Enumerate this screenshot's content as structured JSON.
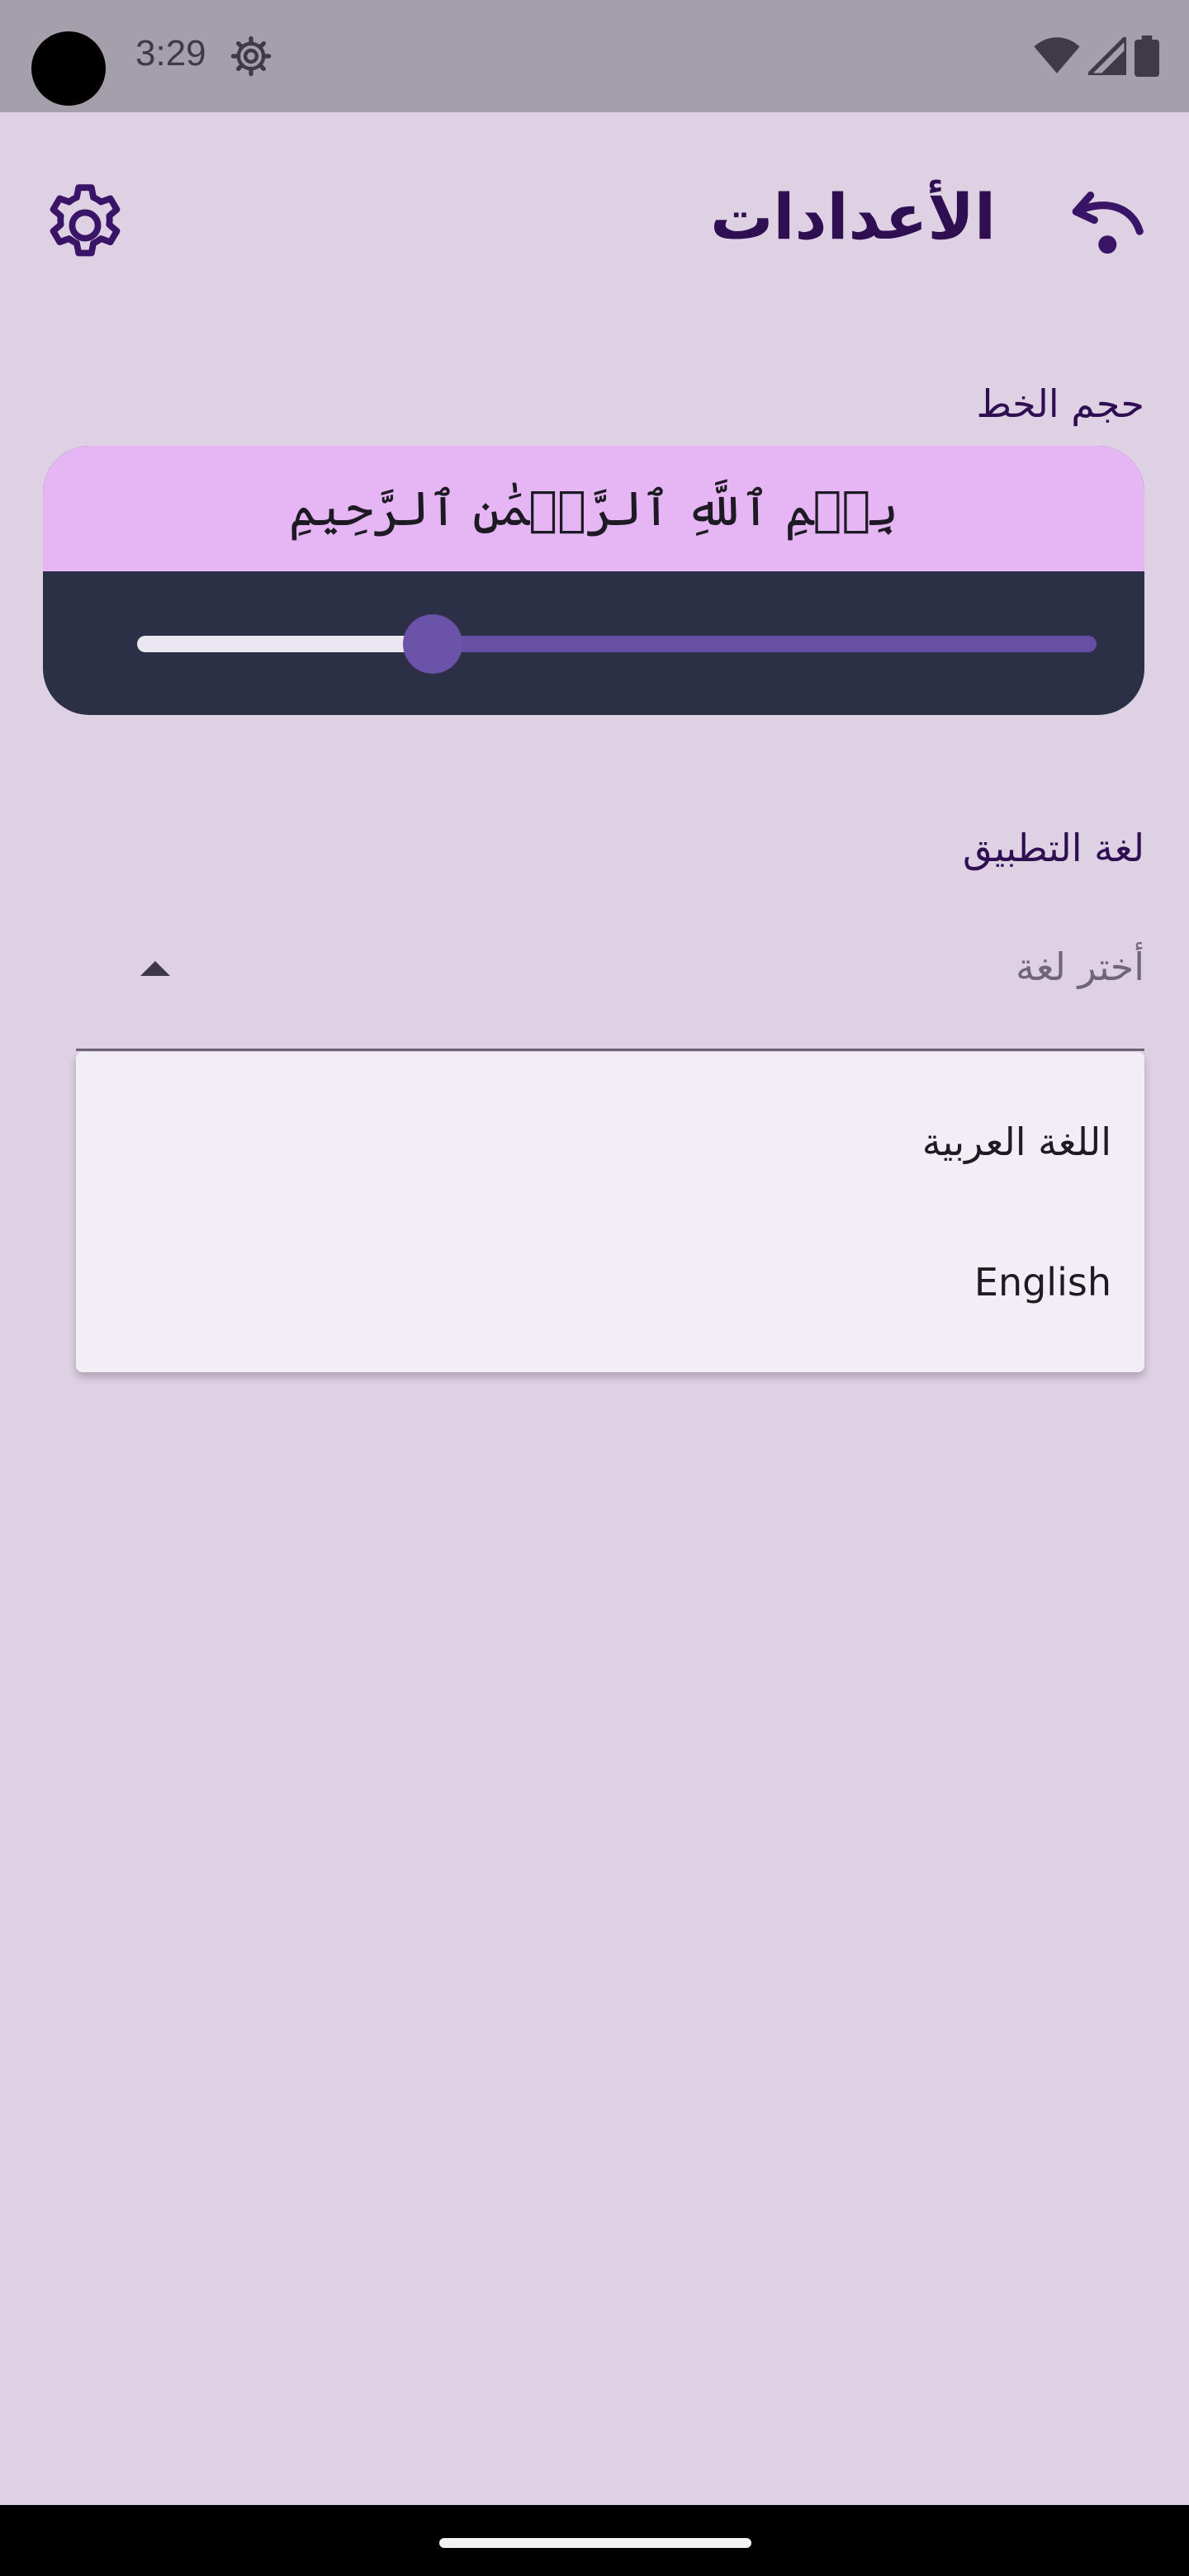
{
  "status_bar": {
    "time": "3:29",
    "icons": [
      "settings-gear-icon",
      "wifi-icon",
      "signal-icon",
      "battery-icon"
    ]
  },
  "header": {
    "title": "الأعدادات",
    "left_icon": "gear-icon",
    "right_icon": "back-icon"
  },
  "font_size": {
    "label": "حجم الخط",
    "preview_text": "بِسۡمِ ٱللَّهِ ٱلرَّحۡمَٰنِ ٱلرَّحِيمِ",
    "slider_value_fraction": 0.28
  },
  "app_language": {
    "label": "لغة التطبيق",
    "placeholder": "أختر لغة",
    "options": [
      "اللغة العربية",
      "English"
    ]
  },
  "colors": {
    "background": "#DDD1E3",
    "preview_bg": "#E5B6F3",
    "slider_card": "#2C3047",
    "accent": "#6750A4",
    "title": "#2F0E52"
  }
}
